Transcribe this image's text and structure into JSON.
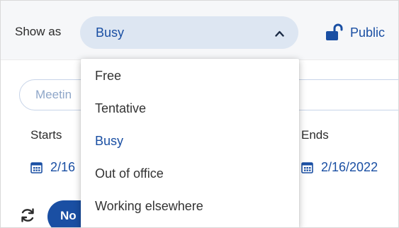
{
  "show_as": {
    "label": "Show as",
    "selected_value": "Busy",
    "expanded": true,
    "options": [
      {
        "label": "Free",
        "selected": false
      },
      {
        "label": "Tentative",
        "selected": false
      },
      {
        "label": "Busy",
        "selected": true
      },
      {
        "label": "Out of office",
        "selected": false
      },
      {
        "label": "Working elsewhere",
        "selected": false
      }
    ]
  },
  "privacy": {
    "label": "Public",
    "icon": "unlock-icon"
  },
  "title_input": {
    "placeholder_visible": "Meetin"
  },
  "starts": {
    "label": "Starts",
    "date_visible": "2/16"
  },
  "ends": {
    "label": "Ends",
    "date": "2/16/2022"
  },
  "footer": {
    "pill_label_visible": "No"
  },
  "colors": {
    "accent": "#1a4fa3",
    "select_bg": "#dde6f2",
    "topbar_bg": "#f6f7f9"
  }
}
